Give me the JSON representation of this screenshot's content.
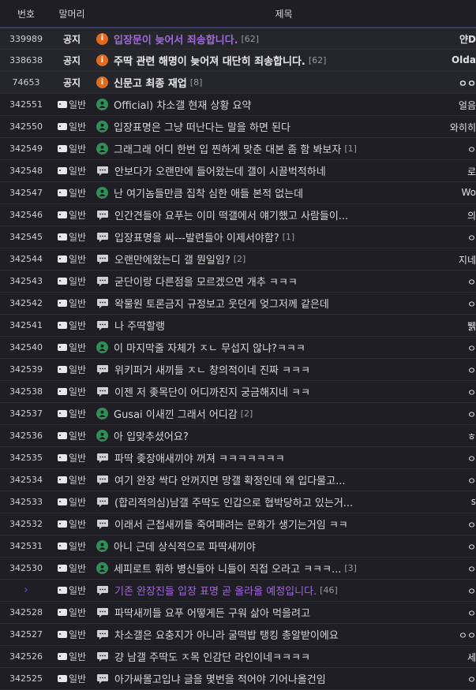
{
  "header": {
    "num": "번호",
    "head": "말머리",
    "title": "제목"
  },
  "rows": [
    {
      "num": "339989",
      "head": "공지",
      "type": "notice",
      "icon": "notice-icon",
      "title": "입장문이 늦어서 죄송합니다.",
      "comments": "[62]",
      "writer": "얀D",
      "purple": true
    },
    {
      "num": "338638",
      "head": "공지",
      "type": "notice",
      "icon": "notice-icon",
      "title": "주딱 관련 해명이 늦어져 대단히 죄송합니다.",
      "comments": "[62]",
      "writer": "Olda",
      "purple": false
    },
    {
      "num": "74653",
      "head": "공지",
      "type": "notice",
      "icon": "notice-icon",
      "title": "신문고 최종 재업",
      "comments": "[8]",
      "writer": "ㅇㅇ",
      "purple": false
    },
    {
      "num": "342551",
      "head": "일반",
      "type": "normal",
      "icon": "image-post-icon",
      "title": "Official) 차소갤 현재 상황 요약",
      "comments": "",
      "writer": "얼음",
      "purple": false
    },
    {
      "num": "342550",
      "head": "일반",
      "type": "normal",
      "icon": "image-post-icon",
      "title": "입장표명은 그냥 떠난다는 말을 하면 된다",
      "comments": "",
      "writer": "와히히",
      "purple": false
    },
    {
      "num": "342549",
      "head": "일반",
      "type": "normal",
      "icon": "image-post-icon",
      "title": "그래그래 어디 한번 입 찐하게 맞춘 대본 좀 함 봐보자",
      "comments": "[1]",
      "writer": "ㅇ",
      "purple": false
    },
    {
      "num": "342548",
      "head": "일반",
      "type": "normal",
      "icon": "text-post-icon",
      "title": "안보다가 오랜만에 들어왔는데 갤이 시끌벅적하네",
      "comments": "",
      "writer": "로",
      "purple": false
    },
    {
      "num": "342547",
      "head": "일반",
      "type": "normal",
      "icon": "image-post-icon",
      "title": "난 여기놈들만큼 집착 심한 애들 본적 없는데",
      "comments": "",
      "writer": "Wo",
      "purple": false
    },
    {
      "num": "342546",
      "head": "일반",
      "type": "normal",
      "icon": "text-post-icon",
      "title": "인간견들아 요푸는 이미 떡갤에서 얘기했고 사람들이...",
      "comments": "",
      "writer": "의",
      "purple": false
    },
    {
      "num": "342545",
      "head": "일반",
      "type": "normal",
      "icon": "text-post-icon",
      "title": "입장표명을 씨---발련들아 이제서야함?",
      "comments": "[1]",
      "writer": "ㅇ",
      "purple": false
    },
    {
      "num": "342544",
      "head": "일반",
      "type": "normal",
      "icon": "text-post-icon",
      "title": "오랜만에왔는디 갤 뭔일임?",
      "comments": "[2]",
      "writer": "지네",
      "purple": false
    },
    {
      "num": "342543",
      "head": "일반",
      "type": "normal",
      "icon": "text-post-icon",
      "title": "굳단이랑 다른점을 모르겠으면 개추 ㅋㅋㅋ",
      "comments": "",
      "writer": "ㅇ",
      "purple": false
    },
    {
      "num": "342542",
      "head": "일반",
      "type": "normal",
      "icon": "text-post-icon",
      "title": "왁물원 토론금지 규정보고 웃던게 엊그저께 같은데",
      "comments": "",
      "writer": "ㅇ",
      "purple": false
    },
    {
      "num": "342541",
      "head": "일반",
      "type": "normal",
      "icon": "text-post-icon",
      "title": "나 주딱할랭",
      "comments": "",
      "writer": "뷁",
      "purple": false
    },
    {
      "num": "342540",
      "head": "일반",
      "type": "normal",
      "icon": "image-post-icon",
      "title": "이 마지막줄 자체가 ㅈㄴ 무섭지 않냐?ㅋㅋㅋ",
      "comments": "",
      "writer": "ㅇ",
      "purple": false
    },
    {
      "num": "342539",
      "head": "일반",
      "type": "normal",
      "icon": "text-post-icon",
      "title": "위키퍼거 새끼들 ㅈㄴ 창의적이네 진짜 ㅋㅋㅋ",
      "comments": "",
      "writer": "ㅇ",
      "purple": false
    },
    {
      "num": "342538",
      "head": "일반",
      "type": "normal",
      "icon": "text-post-icon",
      "title": "이젠 저 좆목단이 어디까진지 궁금해지네 ㅋㅋ",
      "comments": "",
      "writer": "ㅇ",
      "purple": false
    },
    {
      "num": "342537",
      "head": "일반",
      "type": "normal",
      "icon": "image-post-icon",
      "title": "Gusai 이새낀 그래서 어디감",
      "comments": "[2]",
      "writer": "ㅇ",
      "purple": false
    },
    {
      "num": "342536",
      "head": "일반",
      "type": "normal",
      "icon": "image-post-icon",
      "title": "아 입맞추셨어요?",
      "comments": "",
      "writer": "ㅎ",
      "purple": false
    },
    {
      "num": "342535",
      "head": "일반",
      "type": "normal",
      "icon": "text-post-icon",
      "title": "파딱 좆장애새끼야 꺼져 ㅋㅋㅋㅋㅋㅋㅋ",
      "comments": "",
      "writer": "ㅇ",
      "purple": false
    },
    {
      "num": "342534",
      "head": "일반",
      "type": "normal",
      "icon": "text-post-icon",
      "title": "여기 완장 싹다 안꺼지면 망갤 확정인데 왜 입다물고...",
      "comments": "",
      "writer": "ㅇ",
      "purple": false
    },
    {
      "num": "342533",
      "head": "일반",
      "type": "normal",
      "icon": "text-post-icon",
      "title": "(합리적의심)남갤 주딱도 인갑으로 협박당하고 있는거...",
      "comments": "",
      "writer": "s",
      "purple": false
    },
    {
      "num": "342532",
      "head": "일반",
      "type": "normal",
      "icon": "text-post-icon",
      "title": "이래서 근첩새끼들 죽여패려는 문화가 생기는거임 ㅋㅋ",
      "comments": "",
      "writer": "ㅇ",
      "purple": false
    },
    {
      "num": "342531",
      "head": "일반",
      "type": "normal",
      "icon": "image-post-icon",
      "title": "아니 근데 상식적으로 파딱새끼야",
      "comments": "",
      "writer": "ㅇ",
      "purple": false
    },
    {
      "num": "342530",
      "head": "일반",
      "type": "normal",
      "icon": "image-post-icon",
      "title": "세피로트 휘하 병신들아 니들이 직접 오라고 ㅋㅋㅋ...",
      "comments": "[3]",
      "writer": "ㅇ",
      "purple": false
    },
    {
      "num": "",
      "head": "일반",
      "type": "current",
      "icon": "text-post-icon",
      "title": "기존 완장진들 입장 표명 곧 올라올 예정입니다.",
      "comments": "[46]",
      "writer": "ㅇ",
      "purple": true
    },
    {
      "num": "342528",
      "head": "일반",
      "type": "normal",
      "icon": "text-post-icon",
      "title": "파딱새끼들 요푸 어떻게든 구워 삶아 먹을려고",
      "comments": "",
      "writer": "ㅇ",
      "purple": false
    },
    {
      "num": "342527",
      "head": "일반",
      "type": "normal",
      "icon": "text-post-icon",
      "title": "차소갤은 요충지가 아니라 굴떡밥 탱킹 총알받이에요",
      "comments": "",
      "writer": "ㅇㅇ",
      "purple": false
    },
    {
      "num": "342526",
      "head": "일반",
      "type": "normal",
      "icon": "text-post-icon",
      "title": "걍 남갤 주딱도 ㅈ목 인감단 라인이네ㅋㅋㅋㅋ",
      "comments": "",
      "writer": "세",
      "purple": false
    },
    {
      "num": "342525",
      "head": "일반",
      "type": "normal",
      "icon": "text-post-icon",
      "title": "아가싸몰고입냐 글을 몇번을 적어야 기어나올건임",
      "comments": "",
      "writer": "ㅇ",
      "purple": false
    }
  ],
  "colors": {
    "background": "#1e1e24",
    "notice_icon": "#e06a1e",
    "image_icon": "#2f8f56",
    "purple_title": "#a06bd6",
    "header_border": "#3d3d6b"
  }
}
